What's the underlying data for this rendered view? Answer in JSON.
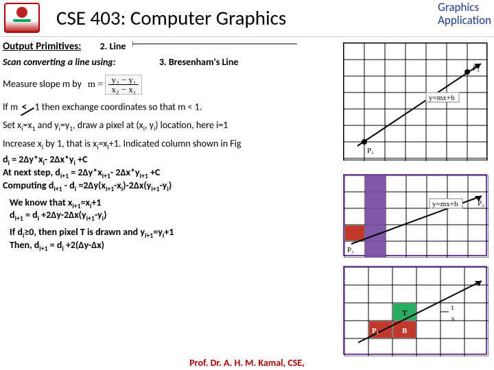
{
  "header": {
    "title": "CSE 403: Computer Graphics",
    "badge_line1": "Graphics",
    "badge_line2": "Application"
  },
  "labels": {
    "output_primitives": "Output Primitives:",
    "line_section": "2. Line",
    "scan_line_prefix": "Scan converting a line using:",
    "bresenham": "3. Bresenham's Line",
    "measure_prefix": "Measure slope m by",
    "frac_num": "y₂ − y₁",
    "frac_den": "x₂ − x₁",
    "frac_m": "m =",
    "ifm_prefix": "If m",
    "ifm_suffix": "1  then exchange coordinates so that m < 1.",
    "set_line_a": "Set x",
    "set_line_b": "=x",
    "set_line_c": " and y",
    "set_line_d": "=y",
    "set_line_e": ", draw a pixel at (x",
    "set_line_f": ", y",
    "set_line_g": ") location, here i=1",
    "inc_a": "Increase x",
    "inc_b": " by 1, that is x",
    "inc_c": "=x",
    "inc_d": "+1. Indicated column shown in Fig",
    "d1": "d",
    "eq": " = ",
    "di_expr": "2Δy*x",
    "minus": "- ",
    "dx_expr": "2Δx*y",
    "plusC": " +C",
    "atnext": "At next step, d",
    "computing": "Computing d",
    "minus_d": " - d",
    "eq2d": " =2Δy(x",
    "dash": "-x",
    "close2dx": ")-2Δx(y",
    "dashy": "-y",
    "closeparen": ")",
    "weknow": "We know that x",
    "eqplus1": "+1",
    "dip1line": "d",
    "dip1expr": " +2Δy-2Δx(y",
    "eq_di": " = d",
    "ifdi": "If d",
    "ifdi_rest": "≥0, then pixel T is drawn and y",
    "ifdi_tail": "=y",
    "then": "Then, d",
    "then_expr": " +2(Δy-Δx)",
    "sub_i": "i",
    "sub_ip1": "i+1",
    "sub_1": "1",
    "sub_2": "2"
  },
  "fig1": {
    "eq": "y=mx+b",
    "p1": "P₁",
    "p2": "P₂"
  },
  "fig2": {
    "eq": "y=mx+b",
    "p1": "P₁",
    "p2": "P₂"
  },
  "fig3": {
    "t": "T",
    "b": "B",
    "p1": "P₁",
    "t_side": "t",
    "s_side": "s"
  },
  "footer": "Prof. Dr. A. H. M. Kamal, CSE,"
}
